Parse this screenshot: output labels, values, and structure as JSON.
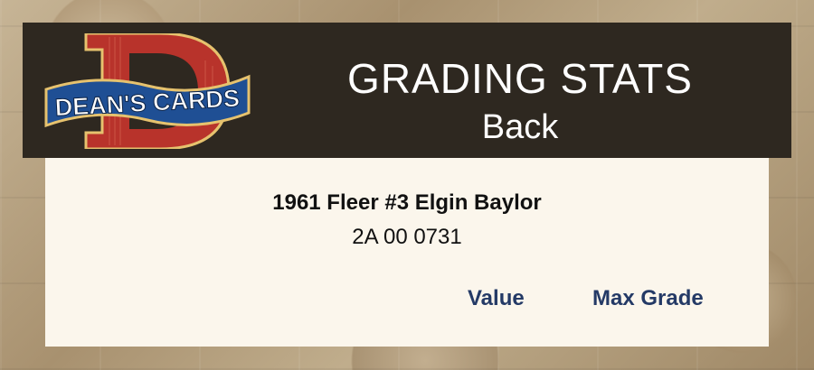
{
  "header": {
    "logo_text": "DEAN'S CARDS",
    "logo_letter": "D",
    "title": "GRADING STATS",
    "subtitle": "Back"
  },
  "card": {
    "name": "1961 Fleer #3 Elgin Baylor",
    "cert_number": "2A 00 0731"
  },
  "columns": {
    "value": "Value",
    "max_grade": "Max Grade"
  },
  "colors": {
    "header_bg": "#2e2820",
    "panel_bg": "#fbf6ec",
    "column_text": "#243a66",
    "logo_red": "#c0392b",
    "logo_blue": "#1f4f94"
  }
}
